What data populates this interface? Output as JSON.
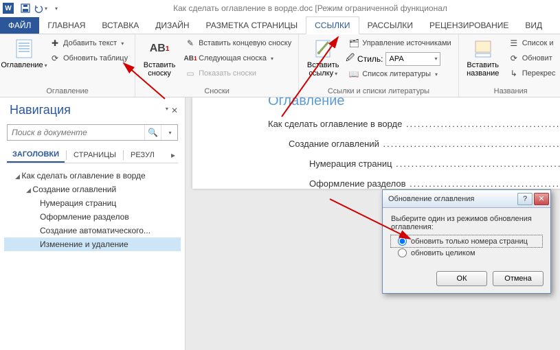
{
  "titlebar": {
    "title": "Как сделать оглавление в ворде.doc [Режим ограниченной функционал"
  },
  "tabs": {
    "file": "ФАЙЛ",
    "home": "ГЛАВНАЯ",
    "insert": "ВСТАВКА",
    "design": "ДИЗАЙН",
    "pagelayout": "РАЗМЕТКА СТРАНИЦЫ",
    "references": "ССЫЛКИ",
    "mailings": "РАССЫЛКИ",
    "review": "РЕЦЕНЗИРОВАНИЕ",
    "view": "ВИД"
  },
  "ribbon": {
    "toc": {
      "big": "Оглавление",
      "add_text": "Добавить текст",
      "update_table": "Обновить таблицу",
      "group": "Оглавление"
    },
    "footnotes": {
      "big": "Вставить\nсноску",
      "ab_label": "AB",
      "insert_endnote": "Вставить концевую сноску",
      "next_footnote": "Следующая сноска",
      "show_notes": "Показать сноски",
      "group": "Сноски"
    },
    "citations": {
      "big": "Вставить\nссылку",
      "manage_sources": "Управление источниками",
      "style_label": "Стиль:",
      "style_value": "APA",
      "bibliography": "Список литературы",
      "group": "Ссылки и списки литературы"
    },
    "captions": {
      "big": "Вставить\nназвание",
      "insert_list": "Список и",
      "update_table": "Обновит",
      "cross_ref": "Перекрес",
      "group": "Названия"
    }
  },
  "nav": {
    "title": "Навигация",
    "search_placeholder": "Поиск в документе",
    "tabs": {
      "headings": "ЗАГОЛОВКИ",
      "pages": "СТРАНИЦЫ",
      "results": "РЕЗУЛ"
    },
    "tree": {
      "l1": "Как сделать оглавление в ворде",
      "l2": "Создание оглавлений",
      "l3a": "Нумерация страниц",
      "l3b": "Оформление разделов",
      "l3c": "Создание автоматического...",
      "l3d": "Изменение и удаление"
    }
  },
  "doc": {
    "title": "Оглавление",
    "line1": "Как сделать оглавление в ворде",
    "line2": "Создание оглавлений",
    "line3": "Нумерация страниц",
    "line4": "Оформление разделов"
  },
  "dialog": {
    "title": "Обновление оглавления",
    "prompt": "Выберите один из режимов обновления оглавления:",
    "opt1": "обновить только номера страниц",
    "opt2": "обновить целиком",
    "ok": "ОК",
    "cancel": "Отмена"
  }
}
